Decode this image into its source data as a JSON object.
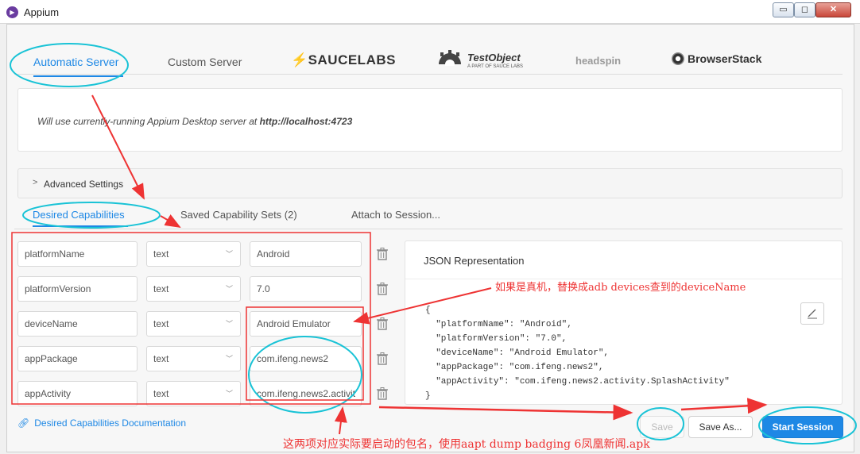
{
  "window": {
    "title": "Appium",
    "controls": {
      "minimize": "▭",
      "maximize": "◻",
      "close": "✕"
    }
  },
  "server_tabs": {
    "automatic": "Automatic Server",
    "custom": "Custom Server",
    "saucelabs": "SAUCELABS",
    "testobject": "TestObject",
    "testobject_sub": "A PART OF SAUCE LABS",
    "headspin": "headspin",
    "browserstack": "BrowserStack"
  },
  "server_info": {
    "prefix": "Will use currently-running Appium Desktop server at ",
    "url": "http://localhost:4723"
  },
  "advanced": {
    "label": "Advanced Settings",
    "chevron": ">"
  },
  "caps_tabs": {
    "desired": "Desired Capabilities",
    "saved": "Saved Capability Sets (2)",
    "attach": "Attach to Session..."
  },
  "capabilities": [
    {
      "name": "platformName",
      "type": "text",
      "value": "Android"
    },
    {
      "name": "platformVersion",
      "type": "text",
      "value": "7.0"
    },
    {
      "name": "deviceName",
      "type": "text",
      "value": "Android Emulator"
    },
    {
      "name": "appPackage",
      "type": "text",
      "value": "com.ifeng.news2"
    },
    {
      "name": "appActivity",
      "type": "text",
      "value": "com.ifeng.news2.activit"
    }
  ],
  "json_panel": {
    "title": "JSON Representation",
    "code": "{\n  \"platformName\": \"Android\",\n  \"platformVersion\": \"7.0\",\n  \"deviceName\": \"Android Emulator\",\n  \"appPackage\": \"com.ifeng.news2\",\n  \"appActivity\": \"com.ifeng.news2.activity.SplashActivity\"\n}"
  },
  "footer": {
    "docs_link": "Desired Capabilities Documentation",
    "save": "Save",
    "save_as": "Save As...",
    "start": "Start Session"
  },
  "annotations": {
    "note_device": "如果是真机，替换成adb devices查到的deviceName",
    "note_package": "这两项对应实际要启动的包名，使用aapt dump badging 6凤凰新闻.apk"
  },
  "colors": {
    "accent": "#1e88e5",
    "annotation": "#ee3333",
    "circle": "#19c3d6"
  }
}
